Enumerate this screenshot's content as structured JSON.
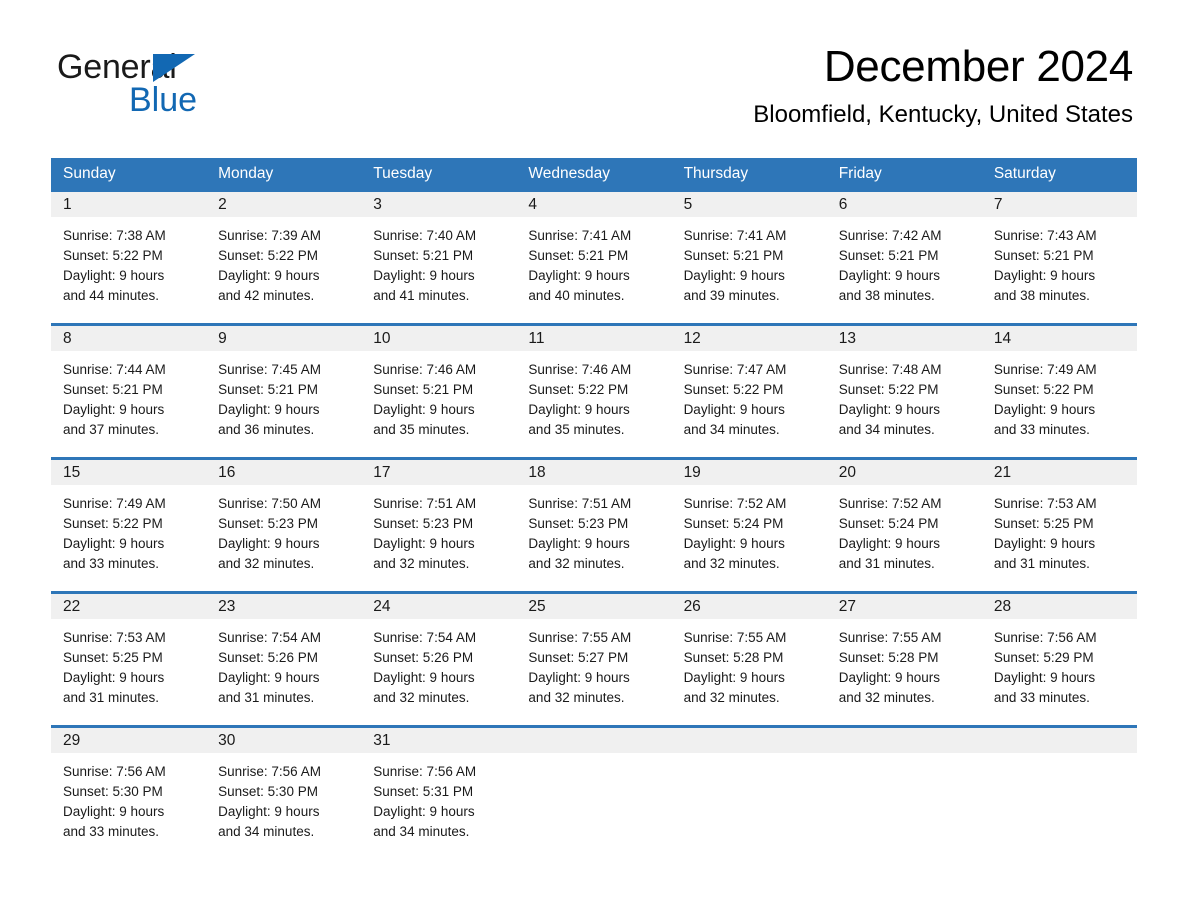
{
  "logo": {
    "word_one": "General",
    "word_two": "Blue",
    "triangle": "blue-triangle-icon",
    "accent_color": "#1268b3"
  },
  "header": {
    "title": "December 2024",
    "subtitle": "Bloomfield, Kentucky, United States"
  },
  "colors": {
    "header_blue": "#2e76b8",
    "daynum_band": "#f0f0f0",
    "text": "#1a1a1a"
  },
  "day_headers": [
    "Sunday",
    "Monday",
    "Tuesday",
    "Wednesday",
    "Thursday",
    "Friday",
    "Saturday"
  ],
  "weeks": [
    [
      {
        "day": "1",
        "lines": [
          "Sunrise: 7:38 AM",
          "Sunset: 5:22 PM",
          "Daylight: 9 hours",
          "and 44 minutes."
        ]
      },
      {
        "day": "2",
        "lines": [
          "Sunrise: 7:39 AM",
          "Sunset: 5:22 PM",
          "Daylight: 9 hours",
          "and 42 minutes."
        ]
      },
      {
        "day": "3",
        "lines": [
          "Sunrise: 7:40 AM",
          "Sunset: 5:21 PM",
          "Daylight: 9 hours",
          "and 41 minutes."
        ]
      },
      {
        "day": "4",
        "lines": [
          "Sunrise: 7:41 AM",
          "Sunset: 5:21 PM",
          "Daylight: 9 hours",
          "and 40 minutes."
        ]
      },
      {
        "day": "5",
        "lines": [
          "Sunrise: 7:41 AM",
          "Sunset: 5:21 PM",
          "Daylight: 9 hours",
          "and 39 minutes."
        ]
      },
      {
        "day": "6",
        "lines": [
          "Sunrise: 7:42 AM",
          "Sunset: 5:21 PM",
          "Daylight: 9 hours",
          "and 38 minutes."
        ]
      },
      {
        "day": "7",
        "lines": [
          "Sunrise: 7:43 AM",
          "Sunset: 5:21 PM",
          "Daylight: 9 hours",
          "and 38 minutes."
        ]
      }
    ],
    [
      {
        "day": "8",
        "lines": [
          "Sunrise: 7:44 AM",
          "Sunset: 5:21 PM",
          "Daylight: 9 hours",
          "and 37 minutes."
        ]
      },
      {
        "day": "9",
        "lines": [
          "Sunrise: 7:45 AM",
          "Sunset: 5:21 PM",
          "Daylight: 9 hours",
          "and 36 minutes."
        ]
      },
      {
        "day": "10",
        "lines": [
          "Sunrise: 7:46 AM",
          "Sunset: 5:21 PM",
          "Daylight: 9 hours",
          "and 35 minutes."
        ]
      },
      {
        "day": "11",
        "lines": [
          "Sunrise: 7:46 AM",
          "Sunset: 5:22 PM",
          "Daylight: 9 hours",
          "and 35 minutes."
        ]
      },
      {
        "day": "12",
        "lines": [
          "Sunrise: 7:47 AM",
          "Sunset: 5:22 PM",
          "Daylight: 9 hours",
          "and 34 minutes."
        ]
      },
      {
        "day": "13",
        "lines": [
          "Sunrise: 7:48 AM",
          "Sunset: 5:22 PM",
          "Daylight: 9 hours",
          "and 34 minutes."
        ]
      },
      {
        "day": "14",
        "lines": [
          "Sunrise: 7:49 AM",
          "Sunset: 5:22 PM",
          "Daylight: 9 hours",
          "and 33 minutes."
        ]
      }
    ],
    [
      {
        "day": "15",
        "lines": [
          "Sunrise: 7:49 AM",
          "Sunset: 5:22 PM",
          "Daylight: 9 hours",
          "and 33 minutes."
        ]
      },
      {
        "day": "16",
        "lines": [
          "Sunrise: 7:50 AM",
          "Sunset: 5:23 PM",
          "Daylight: 9 hours",
          "and 32 minutes."
        ]
      },
      {
        "day": "17",
        "lines": [
          "Sunrise: 7:51 AM",
          "Sunset: 5:23 PM",
          "Daylight: 9 hours",
          "and 32 minutes."
        ]
      },
      {
        "day": "18",
        "lines": [
          "Sunrise: 7:51 AM",
          "Sunset: 5:23 PM",
          "Daylight: 9 hours",
          "and 32 minutes."
        ]
      },
      {
        "day": "19",
        "lines": [
          "Sunrise: 7:52 AM",
          "Sunset: 5:24 PM",
          "Daylight: 9 hours",
          "and 32 minutes."
        ]
      },
      {
        "day": "20",
        "lines": [
          "Sunrise: 7:52 AM",
          "Sunset: 5:24 PM",
          "Daylight: 9 hours",
          "and 31 minutes."
        ]
      },
      {
        "day": "21",
        "lines": [
          "Sunrise: 7:53 AM",
          "Sunset: 5:25 PM",
          "Daylight: 9 hours",
          "and 31 minutes."
        ]
      }
    ],
    [
      {
        "day": "22",
        "lines": [
          "Sunrise: 7:53 AM",
          "Sunset: 5:25 PM",
          "Daylight: 9 hours",
          "and 31 minutes."
        ]
      },
      {
        "day": "23",
        "lines": [
          "Sunrise: 7:54 AM",
          "Sunset: 5:26 PM",
          "Daylight: 9 hours",
          "and 31 minutes."
        ]
      },
      {
        "day": "24",
        "lines": [
          "Sunrise: 7:54 AM",
          "Sunset: 5:26 PM",
          "Daylight: 9 hours",
          "and 32 minutes."
        ]
      },
      {
        "day": "25",
        "lines": [
          "Sunrise: 7:55 AM",
          "Sunset: 5:27 PM",
          "Daylight: 9 hours",
          "and 32 minutes."
        ]
      },
      {
        "day": "26",
        "lines": [
          "Sunrise: 7:55 AM",
          "Sunset: 5:28 PM",
          "Daylight: 9 hours",
          "and 32 minutes."
        ]
      },
      {
        "day": "27",
        "lines": [
          "Sunrise: 7:55 AM",
          "Sunset: 5:28 PM",
          "Daylight: 9 hours",
          "and 32 minutes."
        ]
      },
      {
        "day": "28",
        "lines": [
          "Sunrise: 7:56 AM",
          "Sunset: 5:29 PM",
          "Daylight: 9 hours",
          "and 33 minutes."
        ]
      }
    ],
    [
      {
        "day": "29",
        "lines": [
          "Sunrise: 7:56 AM",
          "Sunset: 5:30 PM",
          "Daylight: 9 hours",
          "and 33 minutes."
        ]
      },
      {
        "day": "30",
        "lines": [
          "Sunrise: 7:56 AM",
          "Sunset: 5:30 PM",
          "Daylight: 9 hours",
          "and 34 minutes."
        ]
      },
      {
        "day": "31",
        "lines": [
          "Sunrise: 7:56 AM",
          "Sunset: 5:31 PM",
          "Daylight: 9 hours",
          "and 34 minutes."
        ]
      },
      {
        "day": "",
        "lines": []
      },
      {
        "day": "",
        "lines": []
      },
      {
        "day": "",
        "lines": []
      },
      {
        "day": "",
        "lines": []
      }
    ]
  ]
}
